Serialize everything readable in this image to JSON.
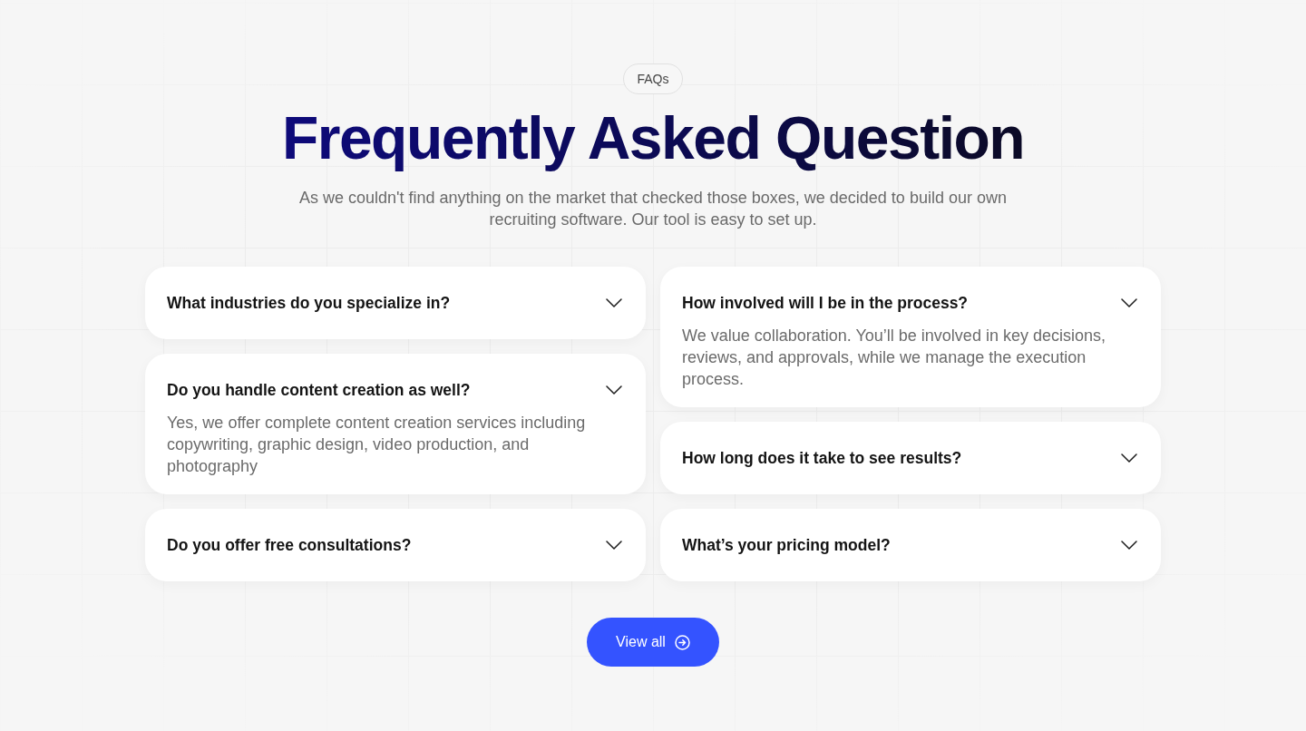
{
  "badge": "FAQs",
  "title": "Frequently Asked Question",
  "subtitle": "As we couldn't find anything on the market that checked those boxes, we decided to build our own recruiting software. Our tool is easy to set up.",
  "faq_columns": [
    {
      "items": [
        {
          "question": "What industries do you specialize in?",
          "expanded": false
        },
        {
          "question": "Do you handle content creation as well?",
          "expanded": true,
          "answer": "Yes, we offer complete content creation services including copywriting, graphic design, video production, and photography"
        },
        {
          "question": "Do you offer free consultations?",
          "expanded": false
        }
      ]
    },
    {
      "items": [
        {
          "question": "How involved will I be in the process?",
          "expanded": true,
          "answer": "We value collaboration. You’ll be involved in key decisions, reviews, and approvals, while we manage the execution process."
        },
        {
          "question": "How long does it take to see results?",
          "expanded": false
        },
        {
          "question": "What’s your pricing model?",
          "expanded": false
        }
      ]
    }
  ],
  "button": {
    "label": "View all"
  }
}
